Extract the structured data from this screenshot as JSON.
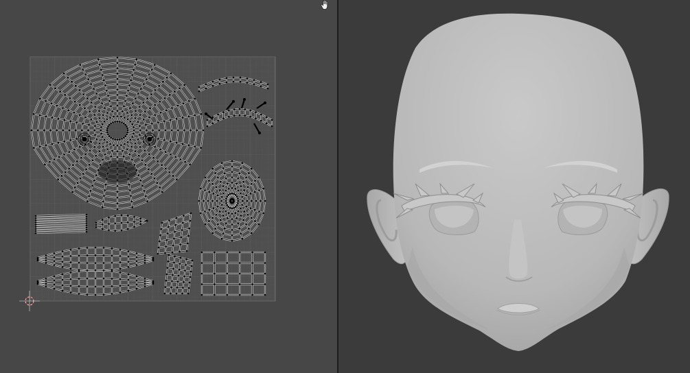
{
  "editors": {
    "left": {
      "type": "UV Editor",
      "tool_icon": "hand-pan-icon",
      "background_color": "#474747",
      "grid_color": "#5d5d5d",
      "wire_color": "#111111",
      "vertex_color": "#000000"
    },
    "right": {
      "type": "3D Viewport",
      "background_color": "#3b3b3b",
      "mesh_color": "#b9b9b9"
    }
  },
  "uv_islands": [
    "head-island",
    "eyebrow-island",
    "eyelash-island",
    "eye-disc-island",
    "block-island",
    "small-wedge-island",
    "angled-island-upper",
    "angled-island-lower",
    "long-strip-upper",
    "long-strip-lower",
    "grid-patch-island"
  ],
  "viewport_object": "head-mesh"
}
